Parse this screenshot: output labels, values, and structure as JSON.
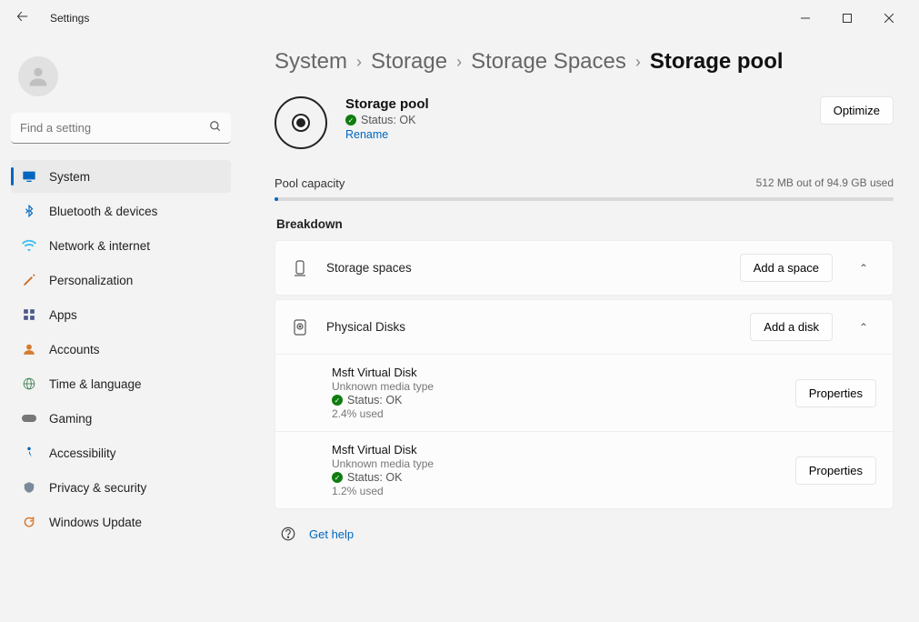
{
  "app_title": "Settings",
  "search": {
    "placeholder": "Find a setting"
  },
  "nav": [
    {
      "label": "System",
      "icon": "🖥️",
      "selected": true
    },
    {
      "label": "Bluetooth & devices",
      "icon": "bt"
    },
    {
      "label": "Network & internet",
      "icon": "🛜"
    },
    {
      "label": "Personalization",
      "icon": "🖌️"
    },
    {
      "label": "Apps",
      "icon": "apps"
    },
    {
      "label": "Accounts",
      "icon": "👤"
    },
    {
      "label": "Time & language",
      "icon": "🌐"
    },
    {
      "label": "Gaming",
      "icon": "🎮"
    },
    {
      "label": "Accessibility",
      "icon": "♿"
    },
    {
      "label": "Privacy & security",
      "icon": "🛡️"
    },
    {
      "label": "Windows Update",
      "icon": "🔄"
    }
  ],
  "breadcrumb": [
    "System",
    "Storage",
    "Storage Spaces",
    "Storage pool"
  ],
  "header": {
    "title": "Storage pool",
    "status_label": "Status: OK",
    "rename_label": "Rename",
    "optimize_label": "Optimize"
  },
  "capacity": {
    "label": "Pool capacity",
    "usage_text": "512 MB out of 94.9 GB used",
    "percent": 0.53
  },
  "breakdown_label": "Breakdown",
  "spaces_panel": {
    "title": "Storage spaces",
    "add_label": "Add a space"
  },
  "disks_panel": {
    "title": "Physical Disks",
    "add_label": "Add a disk",
    "properties_label": "Properties",
    "disks": [
      {
        "name": "Msft Virtual Disk",
        "media": "Unknown media type",
        "status": "Status: OK",
        "used": "2.4% used"
      },
      {
        "name": "Msft Virtual Disk",
        "media": "Unknown media type",
        "status": "Status: OK",
        "used": "1.2% used"
      }
    ]
  },
  "help_label": "Get help"
}
